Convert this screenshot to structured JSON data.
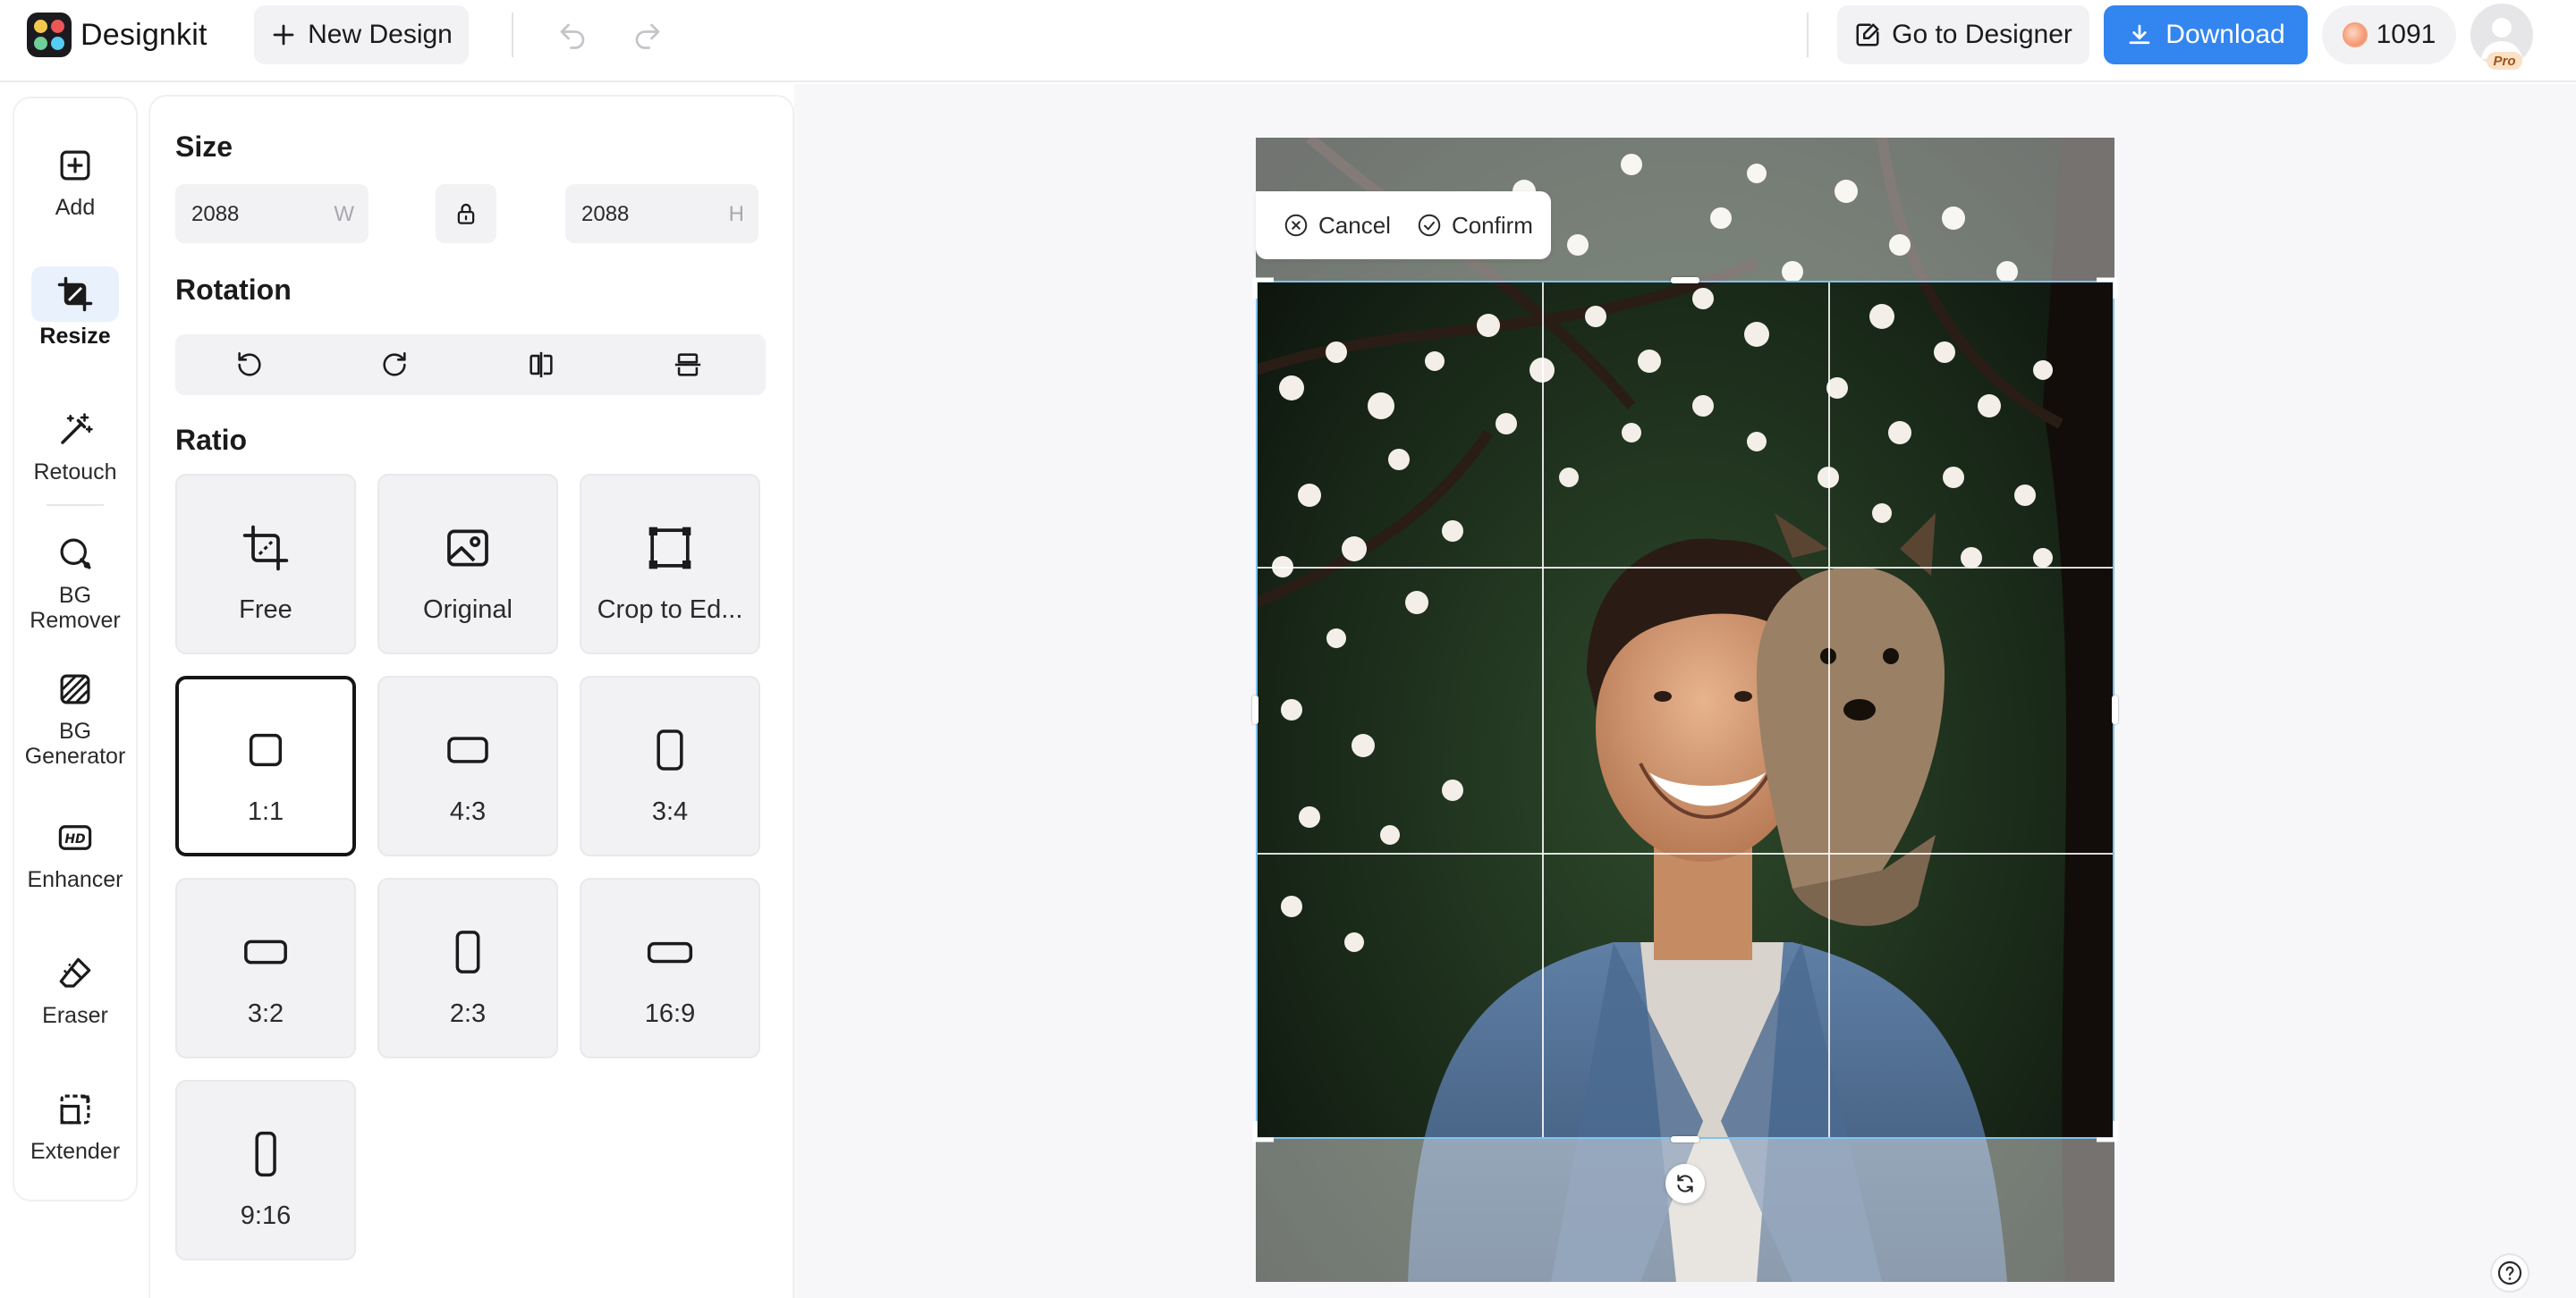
{
  "app": {
    "brand": "Designkit",
    "new_design_label": "New Design",
    "go_to_designer_label": "Go to Designer",
    "download_label": "Download",
    "credits": "1091",
    "plan_badge": "Pro"
  },
  "tools": [
    {
      "label": "Add",
      "icon": "plus-square-icon"
    },
    {
      "label": "Resize",
      "icon": "crop-icon",
      "active": true
    },
    {
      "label": "Retouch",
      "icon": "magic-wand-icon"
    },
    {
      "label": "BG\nRemover",
      "icon": "bg-remover-icon"
    },
    {
      "label": "BG\nGenerator",
      "icon": "bg-generator-icon"
    },
    {
      "label": "Enhancer",
      "icon": "hd-icon"
    },
    {
      "label": "Eraser",
      "icon": "eraser-icon"
    },
    {
      "label": "Extender",
      "icon": "extender-icon"
    }
  ],
  "panel": {
    "size_heading": "Size",
    "width_value": "2088",
    "width_unit": "W",
    "height_value": "2088",
    "height_unit": "H",
    "rotation_heading": "Rotation",
    "ratio_heading": "Ratio",
    "ratios": [
      {
        "label": "Free",
        "icon": "free-crop-icon"
      },
      {
        "label": "Original",
        "icon": "image-icon"
      },
      {
        "label": "Crop to Ed...",
        "icon": "crop-edge-icon"
      },
      {
        "label": "1:1",
        "icon": "ratio-1-1-icon",
        "selected": true
      },
      {
        "label": "4:3",
        "icon": "ratio-4-3-icon"
      },
      {
        "label": "3:4",
        "icon": "ratio-3-4-icon"
      },
      {
        "label": "3:2",
        "icon": "ratio-3-2-icon"
      },
      {
        "label": "2:3",
        "icon": "ratio-2-3-icon"
      },
      {
        "label": "16:9",
        "icon": "ratio-16-9-icon"
      },
      {
        "label": "9:16",
        "icon": "ratio-9-16-icon"
      }
    ]
  },
  "crop_toolbar": {
    "cancel_label": "Cancel",
    "confirm_label": "Confirm"
  },
  "colors": {
    "accent": "#3385f0",
    "active_tool_bg": "#e9f1fd",
    "crop_border": "#7ec3f0"
  }
}
